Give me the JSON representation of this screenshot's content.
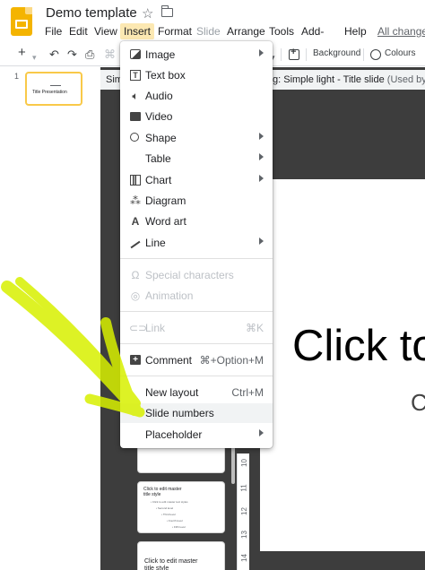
{
  "app": {
    "title": "Demo template",
    "colors": {
      "accent": "#f4b400",
      "active_menu_bg": "#fce8b2",
      "highlighter": "#d8f000",
      "editor_bg": "#3d3d3d"
    }
  },
  "menubar": {
    "items": [
      {
        "label": "File"
      },
      {
        "label": "Edit"
      },
      {
        "label": "View"
      },
      {
        "label": "Insert",
        "active": true
      },
      {
        "label": "Format"
      },
      {
        "label": "Slide",
        "disabled": true
      },
      {
        "label": "Arrange"
      },
      {
        "label": "Tools"
      },
      {
        "label": "Add-ons"
      },
      {
        "label": "Help"
      },
      {
        "label": "All changes"
      }
    ]
  },
  "toolbar": {
    "new_symbol": "+",
    "undo_symbol": "↶",
    "redo_symbol": "↷",
    "print_symbol": "⎙",
    "paint_symbol": "⌘",
    "background_label": "Background",
    "colours_label": "Colours"
  },
  "filmstrip": {
    "slide_number": "1",
    "thumb_text": "Title Presentation"
  },
  "master_bar": {
    "left": "Sim",
    "title": "g: Simple light - Title slide",
    "used": "(Used by all"
  },
  "master_thumbs": [
    {
      "title": "Click to edit master\ntitle style"
    },
    {
      "title": "Click to edit master\ntitle style"
    }
  ],
  "ruler": {
    "numbers": [
      "10",
      "11",
      "12",
      "13",
      "14"
    ]
  },
  "canvas": {
    "title": "Click to",
    "subtitle": "C"
  },
  "insert_menu": {
    "items": [
      {
        "label": "Image",
        "icon": "image-icon",
        "submenu": true
      },
      {
        "label": "Text box",
        "icon": "textbox-icon"
      },
      {
        "label": "Audio",
        "icon": "audio-icon"
      },
      {
        "label": "Video",
        "icon": "video-icon"
      },
      {
        "label": "Shape",
        "icon": "shape-icon",
        "submenu": true
      },
      {
        "label": "Table",
        "icon": "",
        "submenu": true
      },
      {
        "label": "Chart",
        "icon": "chart-icon",
        "submenu": true
      },
      {
        "label": "Diagram",
        "icon": "diagram-icon"
      },
      {
        "label": "Word art",
        "icon": "wordart-icon"
      },
      {
        "label": "Line",
        "icon": "line-icon",
        "submenu": true
      },
      {
        "label": "Special characters",
        "icon": "omega-icon",
        "disabled": true
      },
      {
        "label": "Animation",
        "icon": "animation-icon",
        "disabled": true
      },
      {
        "label": "Link",
        "icon": "link-icon",
        "shortcut": "⌘K",
        "disabled": true
      },
      {
        "label": "Comment",
        "icon": "comment-icon",
        "shortcut": "⌘+Option+M"
      },
      {
        "label": "New layout",
        "icon": "",
        "shortcut": "Ctrl+M"
      },
      {
        "label": "Slide numbers",
        "icon": "",
        "hover": true
      },
      {
        "label": "Placeholder",
        "icon": "",
        "submenu": true
      }
    ]
  }
}
